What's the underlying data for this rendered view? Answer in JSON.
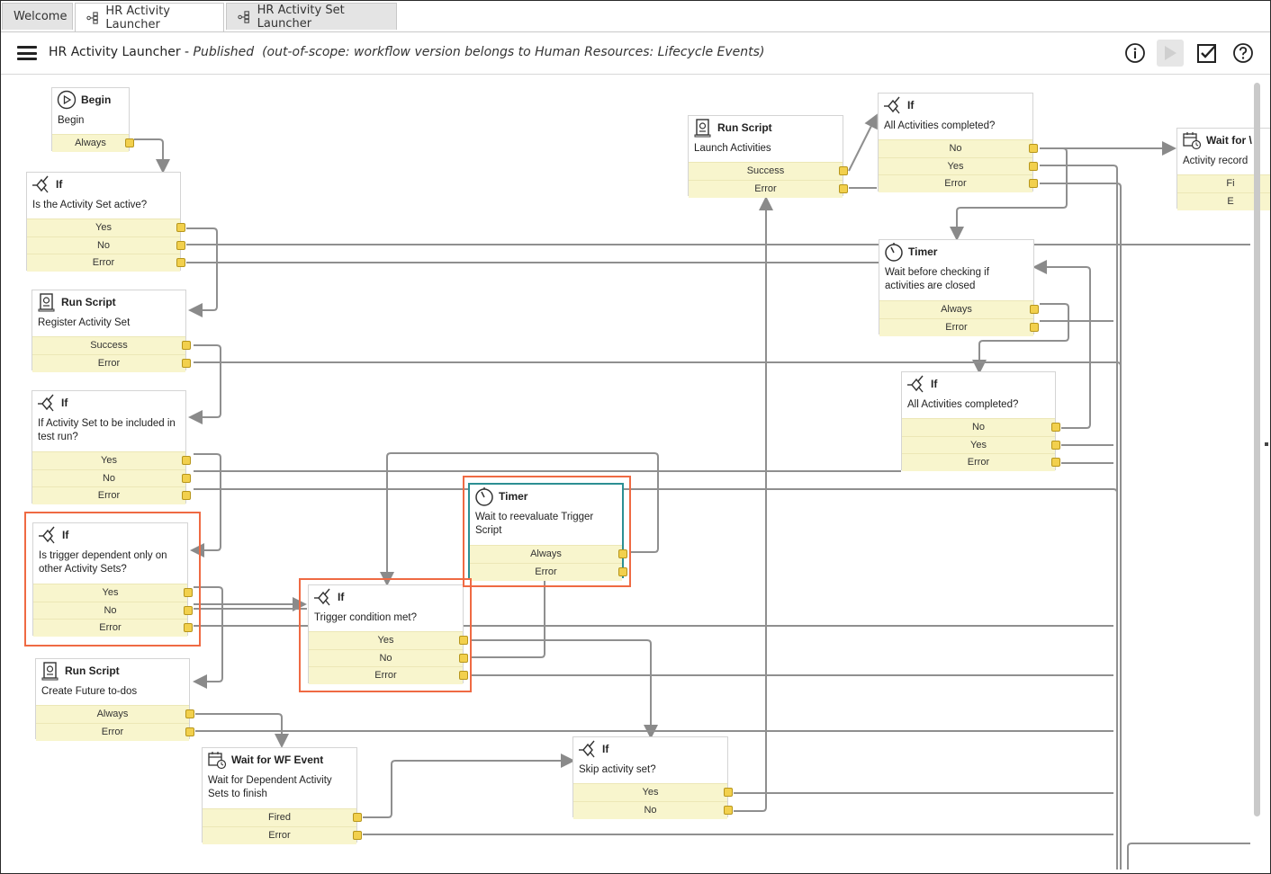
{
  "tabs": [
    {
      "label": "Welcome"
    },
    {
      "label": "HR Activity Launcher"
    },
    {
      "label": "HR Activity Set Launcher"
    }
  ],
  "header": {
    "title": "HR Activity Launcher",
    "separator": " - ",
    "status": "Published",
    "note": "(out-of-scope: workflow version belongs to Human Resources: Lifecycle Events)"
  },
  "colors": {
    "accent_highlight": "#ef6a43",
    "selected_border": "#2c8f93",
    "port_fill": "#f8f5cd",
    "port_dot": "#f2d04d"
  },
  "nodes": [
    {
      "id": "begin",
      "icon": "play-circle-icon",
      "type": "Begin",
      "desc": "Begin",
      "ports": [
        "Always"
      ]
    },
    {
      "id": "if-active",
      "icon": "branch-icon",
      "type": "If",
      "desc": "Is the Activity Set active?",
      "ports": [
        "Yes",
        "No",
        "Error"
      ]
    },
    {
      "id": "rs-register",
      "icon": "script-icon",
      "type": "Run Script",
      "desc": "Register Activity Set",
      "ports": [
        "Success",
        "Error"
      ]
    },
    {
      "id": "if-testrun",
      "icon": "branch-icon",
      "type": "If",
      "desc": "If Activity Set to be included in test run?",
      "ports": [
        "Yes",
        "No",
        "Error"
      ]
    },
    {
      "id": "if-dependent",
      "icon": "branch-icon",
      "type": "If",
      "desc": "Is trigger dependent only on other Activity Sets?",
      "ports": [
        "Yes",
        "No",
        "Error"
      ]
    },
    {
      "id": "rs-future",
      "icon": "script-icon",
      "type": "Run Script",
      "desc": "Create Future to-dos",
      "ports": [
        "Always",
        "Error"
      ]
    },
    {
      "id": "wait-wf",
      "icon": "calendar-clock-icon",
      "type": "Wait for WF Event",
      "desc": "Wait for Dependent Activity Sets to finish",
      "ports": [
        "Fired",
        "Error"
      ]
    },
    {
      "id": "if-trigger",
      "icon": "branch-icon",
      "type": "If",
      "desc": "Trigger condition met?",
      "ports": [
        "Yes",
        "No",
        "Error"
      ]
    },
    {
      "id": "timer-reeval",
      "icon": "timer-icon",
      "type": "Timer",
      "desc": "Wait to reevaluate Trigger Script",
      "ports": [
        "Always",
        "Error"
      ]
    },
    {
      "id": "if-skip",
      "icon": "branch-icon",
      "type": "If",
      "desc": "Skip activity set?",
      "ports": [
        "Yes",
        "No"
      ]
    },
    {
      "id": "rs-launch",
      "icon": "script-icon",
      "type": "Run Script",
      "desc": "Launch Activities",
      "ports": [
        "Success",
        "Error"
      ]
    },
    {
      "id": "if-allcomp1",
      "icon": "branch-icon",
      "type": "If",
      "desc": "All Activities completed?",
      "ports": [
        "No",
        "Yes",
        "Error"
      ]
    },
    {
      "id": "timer-check",
      "icon": "timer-icon",
      "type": "Timer",
      "desc": "Wait before checking if activities are closed",
      "ports": [
        "Always",
        "Error"
      ]
    },
    {
      "id": "if-allcomp2",
      "icon": "branch-icon",
      "type": "If",
      "desc": "All Activities completed?",
      "ports": [
        "No",
        "Yes",
        "Error"
      ]
    },
    {
      "id": "wait-record",
      "icon": "calendar-clock-icon",
      "type": "Wait for \\",
      "desc": "Activity record",
      "ports": [
        "Fi",
        "E"
      ]
    }
  ]
}
